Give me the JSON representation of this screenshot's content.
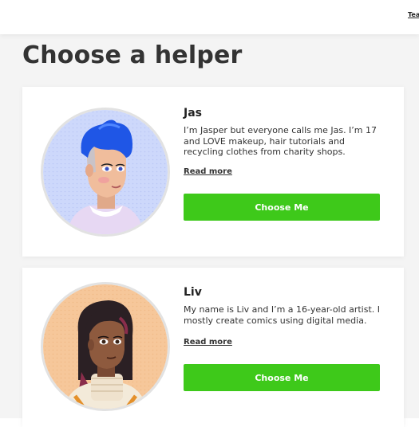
{
  "header": {
    "nav_link": "Teachers"
  },
  "page": {
    "title": "Choose a helper"
  },
  "helpers": [
    {
      "name": "Jas",
      "bio": "I’m Jasper but everyone calls me Jas. I’m 17 and LOVE makeup, hair tutorials and recycling clothes from charity shops.",
      "read_more": "Read more",
      "button": "Choose Me",
      "avatar_bg": "#cdd8fb",
      "hair_color": "#1f56e6"
    },
    {
      "name": "Liv",
      "bio": "My name is Liv and I’m a 16-year-old artist. I mostly create comics using digital media.",
      "read_more": "Read more",
      "button": "Choose Me",
      "avatar_bg": "#f6c79a",
      "hair_color": "#2b2024"
    }
  ],
  "colors": {
    "button_green": "#3ec91a",
    "page_bg": "#f4f4f4",
    "card_bg": "#ffffff"
  }
}
